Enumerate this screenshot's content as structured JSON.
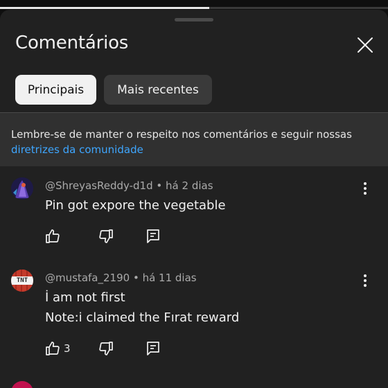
{
  "progress": {
    "fraction": 0.54
  },
  "sheet": {
    "title": "Comentários",
    "close_icon": "close-icon"
  },
  "tabs": [
    {
      "label": "Principais",
      "active": true
    },
    {
      "label": "Mais recentes",
      "active": false
    }
  ],
  "notice": {
    "text": "Lembre-se de manter o respeito nos comentários e seguir nossas",
    "link": "diretrizes da comunidade"
  },
  "comments": [
    {
      "author": "@ShreyasReddy-d1d",
      "time": "há 2 dias",
      "lines": [
        "Pin got expore the vegetable"
      ],
      "likes": "",
      "avatar_icon": "game-character-avatar"
    },
    {
      "author": "@mustafa_2190",
      "time": "há 11 dias",
      "lines": [
        "İ am not first",
        "Note:i claimed the Fırat reward"
      ],
      "likes": "3",
      "avatar_icon": "tnt-block-avatar",
      "avatar_text": "TNT"
    }
  ],
  "colors": {
    "background": "#0f0f0f",
    "sheet": "#212121",
    "notice": "#303030",
    "link": "#3ea6ff",
    "active_chip": "#f1f1f1",
    "inactive_chip": "#3a3a3a"
  }
}
